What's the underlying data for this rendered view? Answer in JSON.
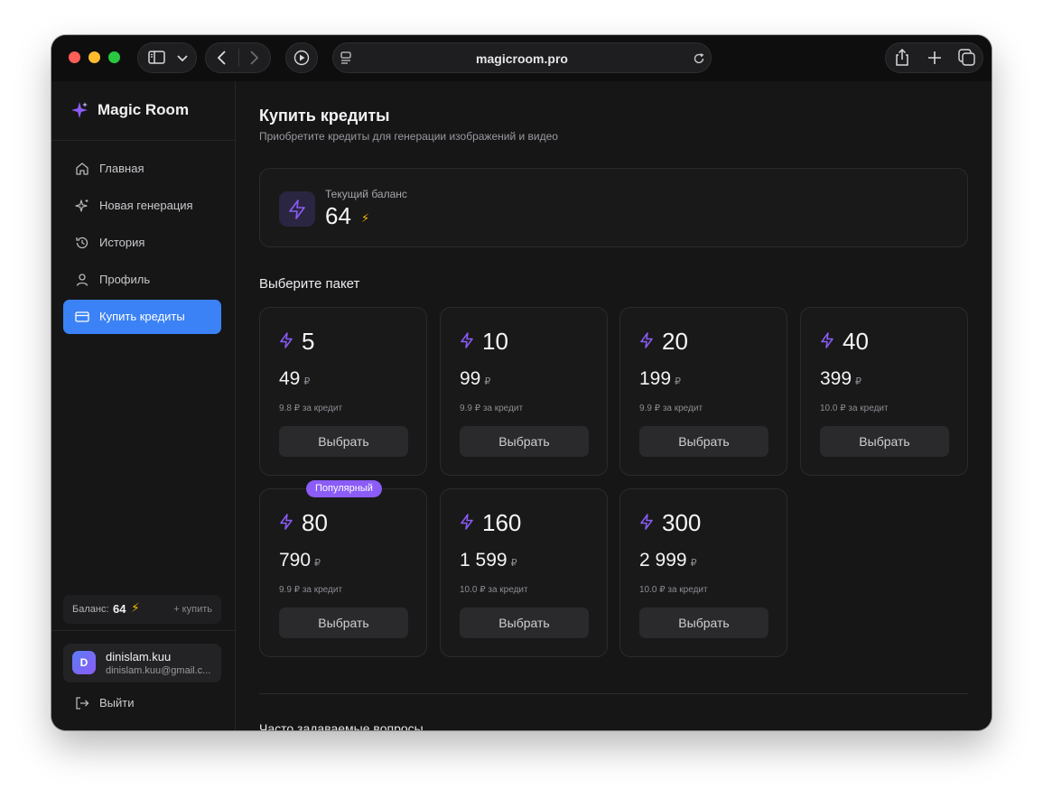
{
  "browser": {
    "url": "magicroom.pro"
  },
  "sidebar": {
    "brand": "Magic Room",
    "items": [
      {
        "label": "Главная",
        "icon": "home-icon"
      },
      {
        "label": "Новая генерация",
        "icon": "sparkles-icon"
      },
      {
        "label": "История",
        "icon": "history-icon"
      },
      {
        "label": "Профиль",
        "icon": "user-icon"
      },
      {
        "label": "Купить кредиты",
        "icon": "credit-card-icon",
        "active": true
      }
    ],
    "balance_label": "Баланс:",
    "balance_value": "64",
    "buy_link": "+ купить",
    "user": {
      "initial": "D",
      "name": "dinislam.kuu",
      "email": "dinislam.kuu@gmail.c..."
    },
    "logout": "Выйти"
  },
  "main": {
    "title": "Купить кредиты",
    "subtitle": "Приобретите кредиты для генерации изображений и видео",
    "balance_label": "Текущий баланс",
    "balance_value": "64",
    "section_title": "Выберите пакет",
    "packages": [
      {
        "credits": "5",
        "price": "49",
        "currency": "₽",
        "per": "9.8 ₽ за кредит",
        "button": "Выбрать"
      },
      {
        "credits": "10",
        "price": "99",
        "currency": "₽",
        "per": "9.9 ₽ за кредит",
        "button": "Выбрать"
      },
      {
        "credits": "20",
        "price": "199",
        "currency": "₽",
        "per": "9.9 ₽ за кредит",
        "button": "Выбрать"
      },
      {
        "credits": "40",
        "price": "399",
        "currency": "₽",
        "per": "10.0 ₽ за кредит",
        "button": "Выбрать"
      },
      {
        "credits": "80",
        "price": "790",
        "currency": "₽",
        "per": "9.9 ₽ за кредит",
        "button": "Выбрать",
        "badge": "Популярный"
      },
      {
        "credits": "160",
        "price": "1 599",
        "currency": "₽",
        "per": "10.0 ₽ за кредит",
        "button": "Выбрать"
      },
      {
        "credits": "300",
        "price": "2 999",
        "currency": "₽",
        "per": "10.0 ₽ за кредит",
        "button": "Выбрать"
      }
    ],
    "faq_title": "Часто задаваемые вопросы"
  },
  "colors": {
    "accent": "#3b82f6",
    "brand_purple": "#8b5cf6",
    "bolt_yellow": "#f5b800"
  }
}
